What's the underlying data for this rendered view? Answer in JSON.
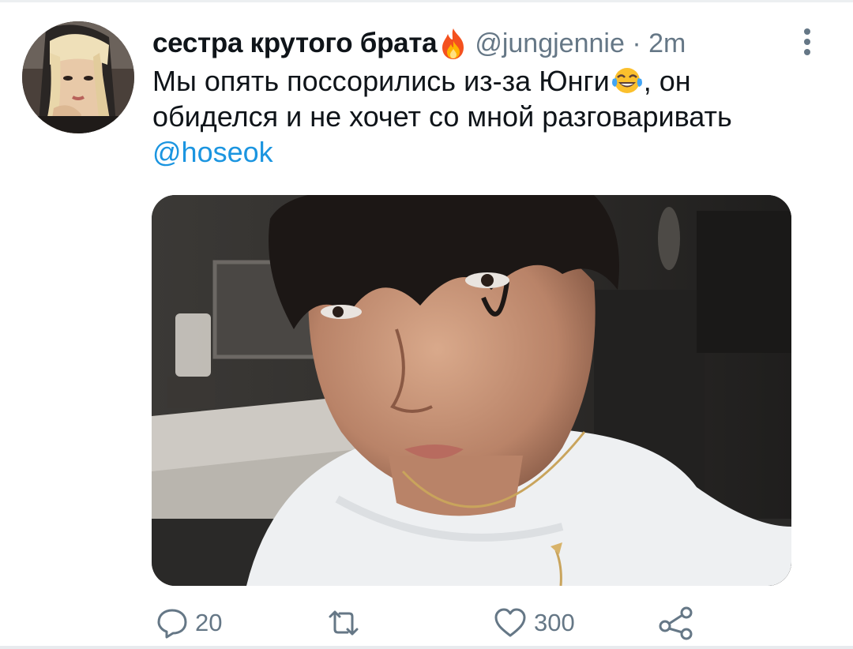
{
  "tweet": {
    "author": {
      "display_name": "сестра крутого брата",
      "name_emoji": "fire-icon",
      "handle": "@jungjennie",
      "separator": " · ",
      "time": "2m"
    },
    "text": {
      "part1": "Мы опять поссорились из-за Юнги",
      "inline_emoji": "face-with-tears-of-joy-icon",
      "part2": ", он обиделся и не хочет со мной разговаривать",
      "mention": "@hoseok"
    },
    "media": {
      "kind": "photo"
    },
    "actions": {
      "reply_count": "20",
      "retweet_count": "",
      "like_count": "300"
    }
  },
  "colors": {
    "link": "#1b95e0",
    "secondary_text": "#657786",
    "primary_text": "#0f1419"
  }
}
